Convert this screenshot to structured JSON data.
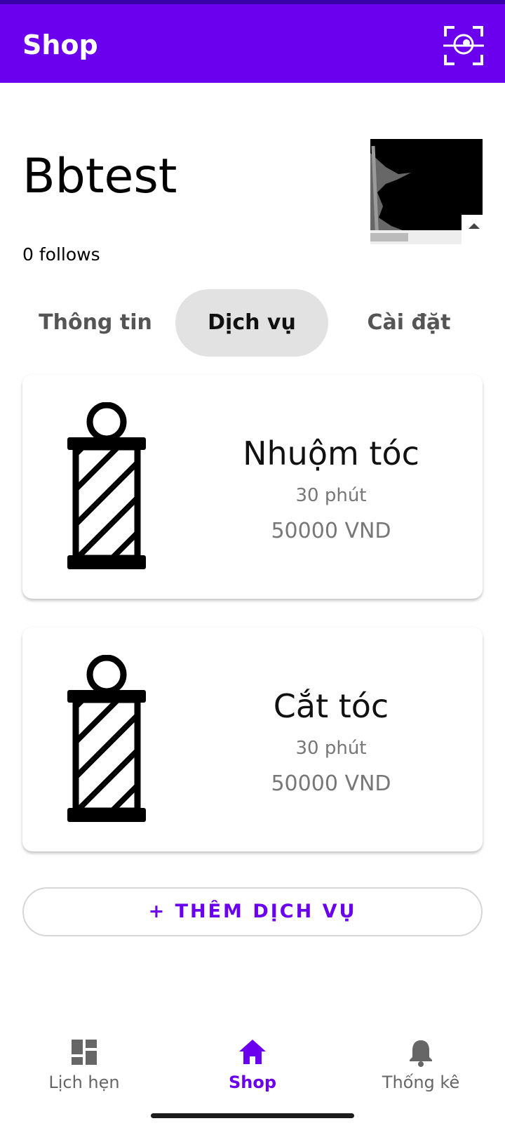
{
  "appbar": {
    "title": "Shop",
    "scan_icon": "face-scan-icon"
  },
  "shop": {
    "name": "Bbtest",
    "follows": "0 follows"
  },
  "tabs": [
    {
      "label": "Thông tin",
      "active": false
    },
    {
      "label": "Dịch vụ",
      "active": true
    },
    {
      "label": "Cài đặt",
      "active": false
    }
  ],
  "services": [
    {
      "name": "Nhuộm tóc",
      "duration": "30 phút",
      "price": "50000 VND",
      "icon": "barber-pole-icon"
    },
    {
      "name": "Cắt tóc",
      "duration": "30 phút",
      "price": "50000 VND",
      "icon": "barber-pole-icon"
    }
  ],
  "add_service_label": "+ THÊM DỊCH VỤ",
  "bottom_nav": [
    {
      "label": "Lịch hẹn",
      "icon": "dashboard-icon",
      "active": false
    },
    {
      "label": "Shop",
      "icon": "home-icon",
      "active": true
    },
    {
      "label": "Thống kê",
      "icon": "bell-icon",
      "active": false
    }
  ],
  "colors": {
    "primary": "#6a00ee",
    "status_bar": "#3a00a8",
    "tab_active_bg": "#e2e2e2"
  }
}
